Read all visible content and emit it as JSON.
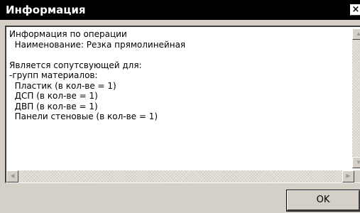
{
  "window": {
    "title": "Информация",
    "close_glyph": "×"
  },
  "info_text": "Информация по операции\n  Наименование: Резка прямолинейная\n\nЯвляется сопутсвующей для:\n-групп материалов:\n  Пластик (в кол-ве = 1)\n  ДСП (в кол-ве = 1)\n  ДВП (в кол-ве = 1)\n  Панели стеновые (в кол-ве = 1)",
  "buttons": {
    "ok_label": "OK"
  },
  "scrollbars": {
    "up_arrow": "▲",
    "down_arrow": "▼",
    "left_arrow": "◀",
    "right_arrow": "▶"
  },
  "colors": {
    "titlebar": "#000000",
    "window_face": "#d4d0c8",
    "text_area": "#ffffff"
  }
}
